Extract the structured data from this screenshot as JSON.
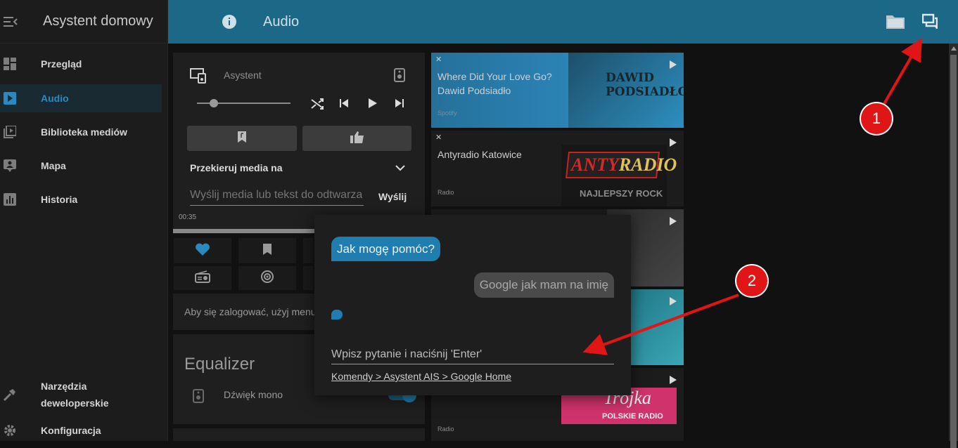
{
  "app": {
    "title": "Asystent domowy"
  },
  "sidebar": {
    "items": [
      {
        "label": "Przegląd",
        "icon": "dashboard-icon"
      },
      {
        "label": "Audio",
        "icon": "play-box-icon",
        "active": true
      },
      {
        "label": "Biblioteka mediów",
        "icon": "media-library-icon"
      },
      {
        "label": "Mapa",
        "icon": "map-account-icon"
      },
      {
        "label": "Historia",
        "icon": "chart-box-icon"
      }
    ],
    "bottom": [
      {
        "label_line1": "Narzędzia",
        "label_line2": "deweloperskie",
        "icon": "hammer-icon"
      },
      {
        "label": "Konfiguracja",
        "icon": "gear-icon"
      }
    ]
  },
  "topbar": {
    "title": "Audio"
  },
  "player": {
    "name": "Asystent",
    "redirect_label": "Przekieruj media na",
    "send_placeholder": "Wyślij media lub tekst do odtwarza",
    "send_button": "Wyślij",
    "time": "00:35",
    "login_text": "Aby się zalogować, użyj menu"
  },
  "equalizer": {
    "title": "Equalizer",
    "mono_label": "Dźwięk mono"
  },
  "media": [
    {
      "title": "Where Did Your Love Go? Dawid Podsiadło",
      "source": "Spotify",
      "art_line1": "DAWID",
      "art_line2": "PODSIADŁO"
    },
    {
      "title": "Antyradio Katowice",
      "source": "Radio",
      "art_line1": "ANTY",
      "art_line2": "RADIO",
      "art_line3": "NAJLEPSZY ROCK"
    },
    {
      "title": "",
      "source": ""
    },
    {
      "title": "",
      "source": ""
    },
    {
      "title": "",
      "source": "Radio",
      "art_line1": "Trójka",
      "art_line2": "POLSKIE RADIO"
    }
  ],
  "dialog": {
    "assistant_message": "Jak mogę pomóc?",
    "user_message": "Google jak mam na imię",
    "input_placeholder": "Wpisz pytanie i naciśnij 'Enter'",
    "link": "Komendy > Asystent AIS > Google Home"
  },
  "annotations": {
    "badge1": "1",
    "badge2": "2"
  },
  "colors": {
    "topbar": "#1b6987",
    "accent": "#1f7db0",
    "badge": "#e01515"
  }
}
